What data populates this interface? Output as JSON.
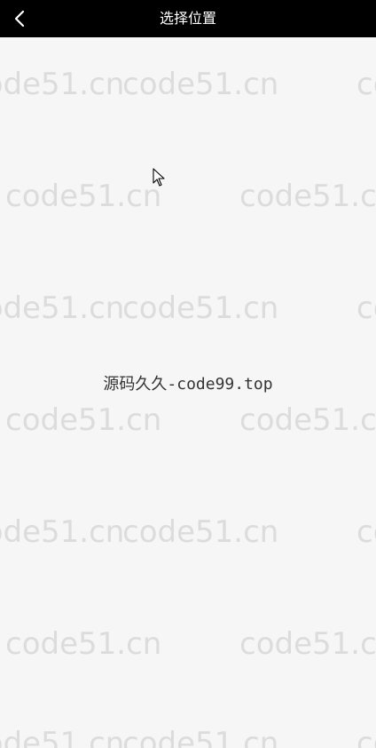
{
  "header": {
    "title": "选择位置",
    "back_icon": "chevron-left-icon"
  },
  "main": {
    "center_text": "源码久久-code99.top"
  },
  "watermark": {
    "text": "code51.cn"
  },
  "colors": {
    "header_bg": "#000000",
    "page_bg": "#f6f6f6",
    "watermark": "#dcdcdc",
    "text": "#333333"
  }
}
